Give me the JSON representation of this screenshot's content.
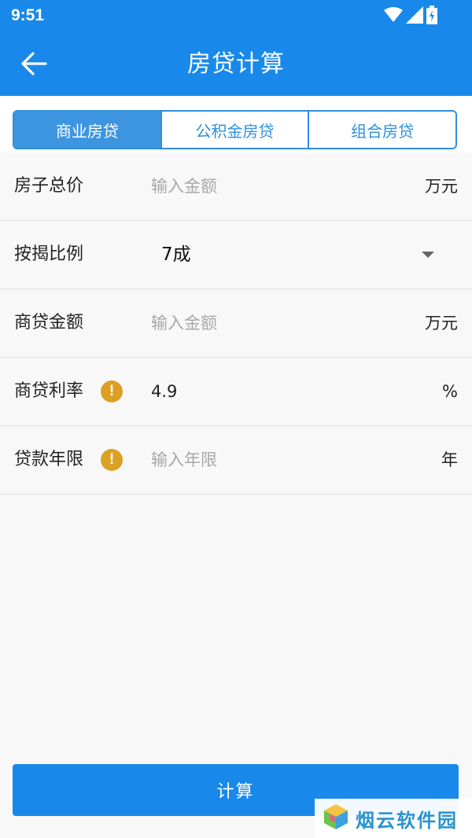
{
  "status_bar": {
    "time": "9:51"
  },
  "header": {
    "title": "房贷计算"
  },
  "tabs": [
    {
      "label": "商业房贷",
      "active": true
    },
    {
      "label": "公积金房贷",
      "active": false
    },
    {
      "label": "组合房贷",
      "active": false
    }
  ],
  "form": {
    "total_price": {
      "label": "房子总价",
      "placeholder": "输入金额",
      "value": "",
      "unit": "万元"
    },
    "down_payment": {
      "label": "按揭比例",
      "selected": "7成"
    },
    "loan_amount": {
      "label": "商贷金额",
      "placeholder": "输入金额",
      "value": "",
      "unit": "万元"
    },
    "interest_rate": {
      "label": "商贷利率",
      "value": "4.9",
      "unit": "%"
    },
    "loan_term": {
      "label": "贷款年限",
      "placeholder": "输入年限",
      "value": "",
      "unit": "年"
    }
  },
  "calculate_button": {
    "label": "计算"
  },
  "watermark": {
    "text": "烟云软件园"
  },
  "colors": {
    "primary": "#1889ea",
    "tab_active": "#3d95e0",
    "warning": "#dba024"
  },
  "icons": {
    "back": "arrow-left-icon",
    "warning": "exclamation-circle-icon",
    "dropdown": "caret-down-icon"
  }
}
